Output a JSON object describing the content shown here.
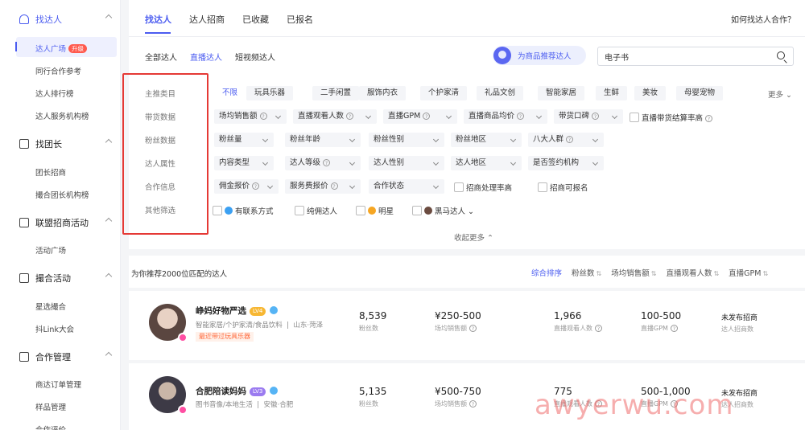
{
  "sidebar": {
    "sections": [
      {
        "label": "找达人",
        "items": [
          "达人广场",
          "同行合作参考",
          "达人排行榜",
          "达人服务机构榜"
        ]
      },
      {
        "label": "找团长",
        "items": [
          "团长招商",
          "撮合团长机构榜"
        ]
      },
      {
        "label": "联盟招商活动",
        "items": [
          "活动广场"
        ]
      },
      {
        "label": "撮合活动",
        "items": [
          "星选撮合",
          "抖Link大会"
        ]
      },
      {
        "label": "合作管理",
        "items": [
          "商达订单管理",
          "样品管理",
          "合作评价"
        ]
      }
    ],
    "badge_up": "升级"
  },
  "tabs": [
    "找达人",
    "达人招商",
    "已收藏",
    "已报名"
  ],
  "help_link": "如何找达人合作？",
  "subtabs": [
    "全部达人",
    "直播达人",
    "短视频达人"
  ],
  "recommend_button": "为商品推荐达人",
  "search": {
    "value": "电子书"
  },
  "filters": {
    "labels": [
      "主推类目",
      "带货数据",
      "粉丝数据",
      "达人属性",
      "合作信息",
      "其他筛选"
    ],
    "categories": [
      "不限",
      "玩具乐器",
      "二手闲置",
      "服饰内衣",
      "个护家清",
      "礼品文创",
      "智能家居",
      "生鲜",
      "美妆",
      "母婴宠物"
    ],
    "more": "更多",
    "sales": [
      "场均销售额",
      "直播观看人数",
      "直播GPM",
      "直播商品均价",
      "带货口碑"
    ],
    "sales_checkbox": "直播带货结算率高",
    "fans": [
      "粉丝量",
      "粉丝年龄",
      "粉丝性别",
      "粉丝地区",
      "八大人群"
    ],
    "attrs": [
      "内容类型",
      "达人等级",
      "达人性别",
      "达人地区",
      "是否签约机构"
    ],
    "coop": [
      "佣金报价",
      "服务费报价",
      "合作状态"
    ],
    "coop_checkboxes": [
      "招商处理率高",
      "招商可报名"
    ],
    "other": [
      "有联系方式",
      "纯佣达人",
      "明星",
      "黑马达人"
    ],
    "collapse": "收起更多"
  },
  "results": {
    "title": "为你推荐2000位匹配的达人",
    "sorts": [
      "综合排序",
      "粉丝数",
      "场均销售额",
      "直播观看人数",
      "直播GPM"
    ]
  },
  "creators": [
    {
      "name": "峥妈好物严选",
      "level": "LV4",
      "tags": "智能家居/个护家清/食品饮料",
      "location": "山东·菏泽",
      "note": "最近带过玩具乐器",
      "fans": "8,539",
      "sales": "¥250-500",
      "viewers": "1,966",
      "gpm": "100-500",
      "recruit": "未发布招商"
    },
    {
      "name": "合肥陪读妈妈",
      "level": "LV3",
      "tags": "图书音像/本地生活",
      "location": "安徽·合肥",
      "note": "",
      "fans": "5,135",
      "sales": "¥500-750",
      "viewers": "775",
      "gpm": "500-1,000",
      "recruit": "未发布招商"
    }
  ],
  "stat_labels": {
    "fans": "粉丝数",
    "sales": "场均销售额",
    "viewers": "直播观看人数",
    "gpm": "直播GPM",
    "recruit": "达人招商数"
  },
  "watermark": "awyerwu.com",
  "colors": {
    "accent": "#4b5cf0",
    "highlight_box": "#e53935"
  }
}
